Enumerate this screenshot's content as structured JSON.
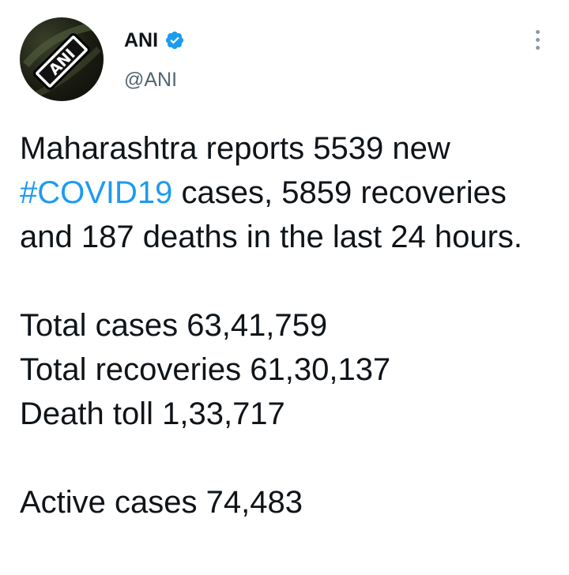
{
  "author": {
    "display_name": "ANI",
    "handle": "@ANI",
    "avatar_text": "ANI",
    "verified": true,
    "verified_color": "#1d9bf0"
  },
  "tweet": {
    "intro_1": "Maharashtra reports 5539 new",
    "hashtag": "#COVID19",
    "intro_2": " cases, 5859 recoveries and 187 deaths in the last 24 hours.",
    "stats": [
      "Total cases 63,41,759",
      "Total recoveries 61,30,137",
      "Death toll 1,33,717"
    ],
    "active": "Active cases 74,483"
  },
  "icons": {
    "more": "more-vertical-icon",
    "verified": "verified-badge-icon"
  },
  "colors": {
    "text": "#0f1419",
    "secondary": "#536471",
    "link": "#1d9bf0"
  }
}
